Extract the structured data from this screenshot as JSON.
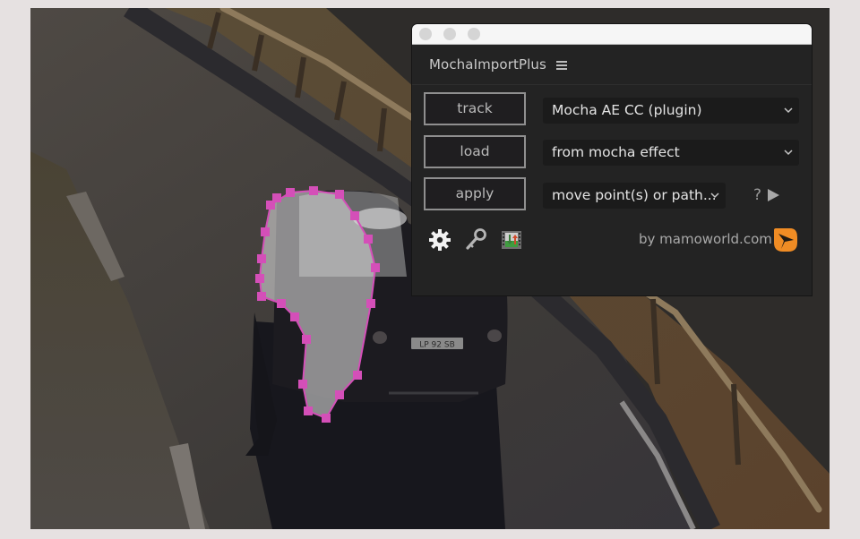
{
  "scene": {
    "description": "Aerial video frame of a car on a curved mountain road with a wooden guardrail; a magenta mask path with control points outlines a region over the car",
    "license_plate": "LP 92 SB",
    "mask_color": "#d44fb8"
  },
  "window": {
    "traffic_lights": [
      "close",
      "minimize",
      "zoom"
    ]
  },
  "panel": {
    "title": "MochaImportPlus",
    "menu_icon": "hamburger-menu-icon",
    "rows": [
      {
        "button": "track",
        "dropdown": "Mocha AE CC (plugin)"
      },
      {
        "button": "load",
        "dropdown": "from mocha effect"
      },
      {
        "button": "apply",
        "dropdown": "move point(s) or path..."
      }
    ],
    "help_label": "?",
    "play_icon": "play-icon",
    "tools": [
      "gear-icon",
      "key-icon",
      "film-import-icon"
    ],
    "credit": "by mamoworld.com",
    "logo": "mamoworld-logo-icon"
  },
  "colors": {
    "panel_bg": "#232323",
    "button_border": "#8f8f8f",
    "dropdown_bg": "#1b1b1b",
    "logo_orange": "#f08c24",
    "mask_magenta": "#d44fb8"
  }
}
